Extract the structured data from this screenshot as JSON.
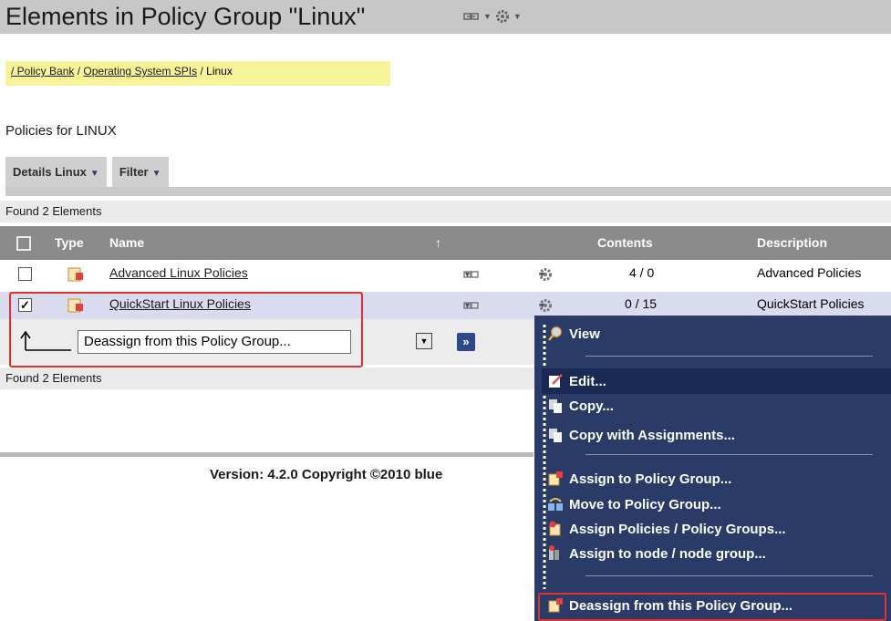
{
  "header": {
    "title": "Elements in Policy Group \"Linux\"",
    "icons": [
      "link-menu-icon",
      "gear-icon"
    ]
  },
  "breadcrumb": {
    "items": [
      "/ Policy Bank",
      "Operating System SPIs",
      "Linux"
    ],
    "separator": "/"
  },
  "section": {
    "heading": "Policies for LINUX"
  },
  "tabs": [
    {
      "label": "Details Linux"
    },
    {
      "label": "Filter"
    }
  ],
  "found": {
    "top": "Found 2 Elements",
    "bottom": "Found 2 Elements"
  },
  "table": {
    "columns": {
      "type": "Type",
      "name": "Name",
      "sort_indicator": "↑",
      "contents": "Contents",
      "description": "Description"
    },
    "rows": [
      {
        "checked": false,
        "name": "Advanced Linux Policies",
        "contents": "4 / 0",
        "description": "Advanced Policies"
      },
      {
        "checked": true,
        "name": "QuickStart Linux Policies",
        "contents": "0 / 15",
        "description": "QuickStart Policies"
      }
    ]
  },
  "bulk_action": {
    "selected": "Deassign from this Policy Group...",
    "go_label": "»"
  },
  "footer": {
    "version": "Version: 4.2.0   Copyright ©2010 blue"
  },
  "context_menu": {
    "items": [
      {
        "label": "View",
        "icon": "magnifier-icon"
      },
      {
        "label": "Edit...",
        "icon": "edit-icon"
      },
      {
        "label": "Copy...",
        "icon": "copy-icon"
      },
      {
        "label": "Copy with Assignments...",
        "icon": "copy-icon"
      },
      {
        "label": "Assign to Policy Group...",
        "icon": "assign-icon"
      },
      {
        "label": "Move to Policy Group...",
        "icon": "move-icon"
      },
      {
        "label": "Assign Policies / Policy Groups...",
        "icon": "assign-policies-icon"
      },
      {
        "label": "Assign to node / node group...",
        "icon": "node-icon"
      },
      {
        "label": "Deassign from this Policy Group...",
        "icon": "deassign-icon"
      }
    ]
  },
  "colors": {
    "title_bar": "#c7c7c7",
    "breadcrumb_bg": "#f7f39b",
    "table_header": "#8b8b8b",
    "selected_row": "#d9dcef",
    "menu_bg": "#2a3b67",
    "menu_highlight": "#1b2a55",
    "callout_red": "#e03030"
  }
}
